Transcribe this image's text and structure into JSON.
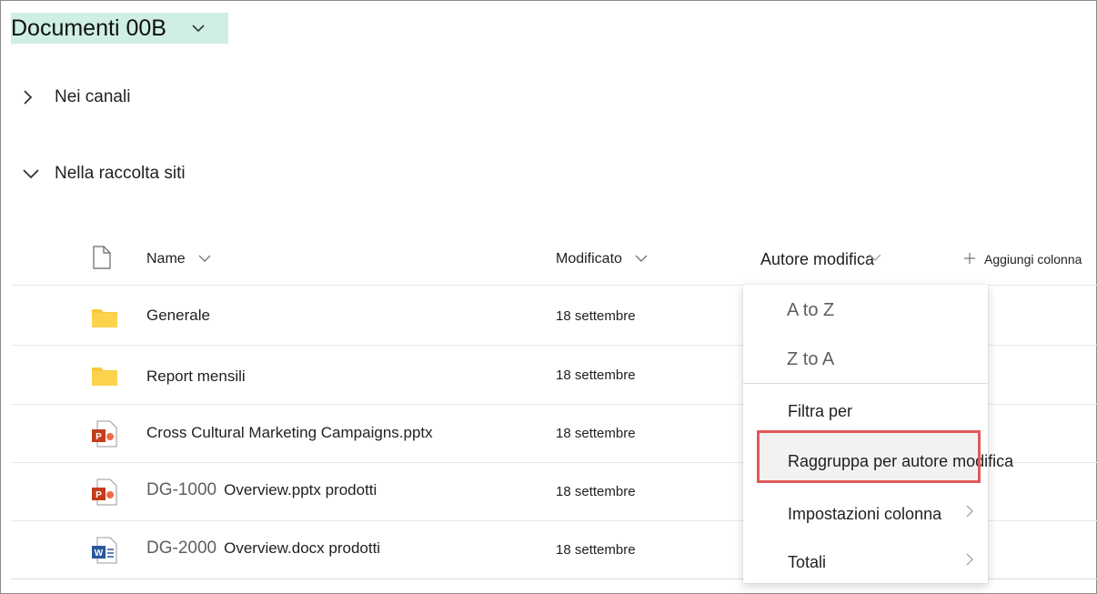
{
  "library": {
    "title": "Documenti 00B"
  },
  "sections": {
    "channels": "Nei canali",
    "site_library": "Nella raccolta siti"
  },
  "columns": {
    "name": "Name",
    "modified": "Modificato",
    "modified_by": "Autore modifica",
    "add_column": "Aggiungi colonna"
  },
  "rows": [
    {
      "prefix": "",
      "name": "Generale",
      "date": "18 settembre",
      "icon": "folder-icon"
    },
    {
      "prefix": "",
      "name": "Report mensili",
      "date": "18 settembre",
      "icon": "folder-icon"
    },
    {
      "prefix": "",
      "name": "Cross Cultural Marketing Campaigns.pptx",
      "date": "18 settembre",
      "icon": "powerpoint-icon"
    },
    {
      "prefix": "DG-1000",
      "name": "Overview.pptx prodotti",
      "date": "18 settembre",
      "icon": "powerpoint-icon"
    },
    {
      "prefix": "DG-2000",
      "name": "Overview.docx prodotti",
      "date": "18 settembre",
      "icon": "word-icon"
    }
  ],
  "menu": {
    "sort_asc": "A to Z",
    "sort_desc": "Z to A",
    "filter_by": "Filtra per",
    "group_by": "Raggruppa per autore modifica",
    "column_settings": "Impostazioni colonna",
    "totals": "Totali"
  },
  "colors": {
    "title_highlight": "#cfeee4",
    "folder": "#f8c93a",
    "powerpoint": "#c43e1c",
    "word": "#2b579a",
    "callout": "#e05a5a"
  }
}
